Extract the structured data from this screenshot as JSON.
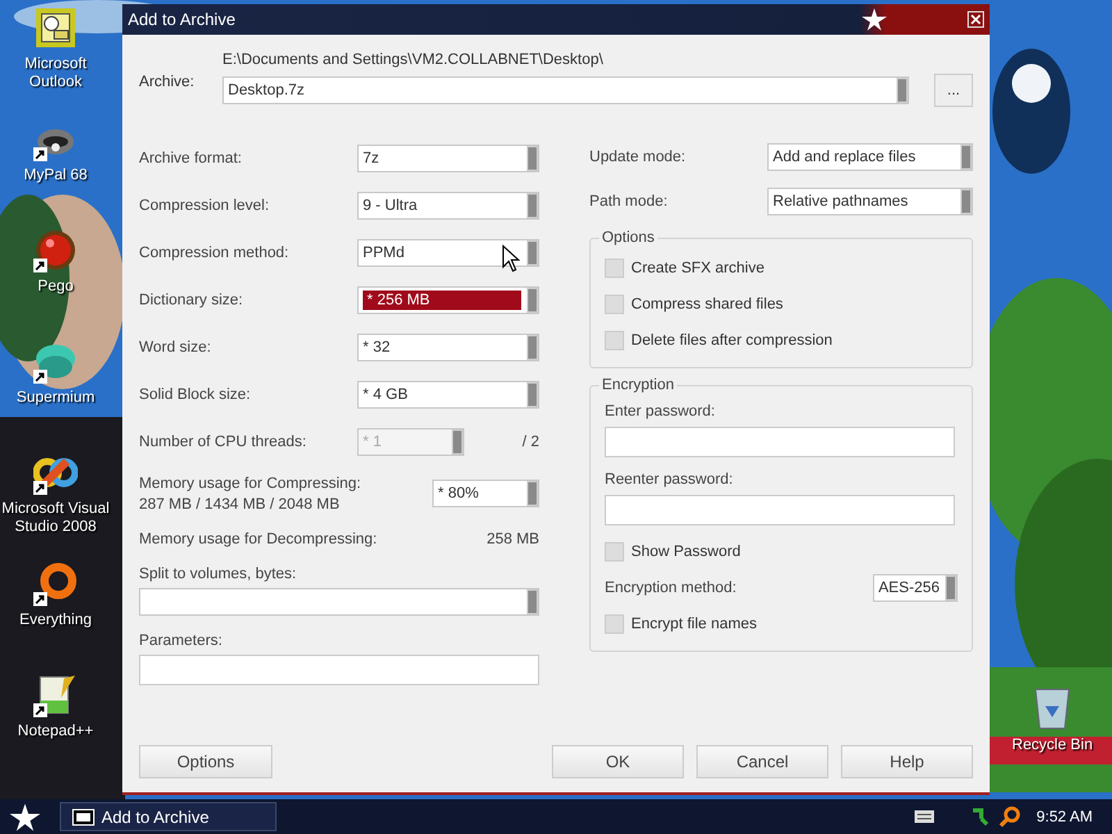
{
  "desktop_icons": [
    {
      "label": "Microsoft Outlook",
      "kind": "outlook",
      "shortcut": false
    },
    {
      "label": "MyPal 68",
      "kind": "raccoon",
      "shortcut": true
    },
    {
      "label": "Pego",
      "kind": "red-ball",
      "shortcut": true
    },
    {
      "label": "Supermium",
      "kind": "teal-blob",
      "shortcut": true
    },
    {
      "label": "Microsoft Visual Studio 2008",
      "kind": "infinity",
      "shortcut": true
    },
    {
      "label": "Everything",
      "kind": "ring",
      "shortcut": true
    },
    {
      "label": "Notepad++",
      "kind": "notepad",
      "shortcut": true
    }
  ],
  "recycle_bin": {
    "label": "Recycle Bin"
  },
  "window": {
    "title": "Add to Archive",
    "archive": {
      "label": "Archive:",
      "path": "E:\\Documents and Settings\\VM2.COLLABNET\\Desktop\\",
      "value": "Desktop.7z",
      "browse": "..."
    },
    "left_rows": [
      {
        "label": "Archive format:",
        "value": "7z",
        "highlighted": false
      },
      {
        "label": "Compression level:",
        "value": "9 - Ultra",
        "highlighted": false
      },
      {
        "label": "Compression method:",
        "value": "PPMd",
        "highlighted": false
      },
      {
        "label": "Dictionary size:",
        "value": "* 256 MB",
        "highlighted": true
      },
      {
        "label": "Word size:",
        "value": "* 32",
        "highlighted": false
      },
      {
        "label": "Solid Block size:",
        "value": "* 4 GB",
        "highlighted": false
      }
    ],
    "cpu_threads": {
      "label": "Number of CPU threads:",
      "value": "* 1",
      "disabled": true,
      "max": "/ 2"
    },
    "memory_compress": {
      "label": "Memory usage for Compressing:",
      "detail": "287 MB / 1434 MB / 2048 MB",
      "value": "* 80%"
    },
    "memory_decompress": {
      "label": "Memory usage for Decompressing:",
      "value": "258 MB"
    },
    "split": {
      "label": "Split to volumes, bytes:"
    },
    "parameters": {
      "label": "Parameters:"
    },
    "options_button": "Options",
    "right_rows": [
      {
        "label": "Update mode:",
        "value": "Add and replace files"
      },
      {
        "label": "Path mode:",
        "value": "Relative pathnames"
      }
    ],
    "options_group": {
      "title": "Options",
      "checkboxes": [
        {
          "label": "Create SFX archive",
          "checked": false
        },
        {
          "label": "Compress shared files",
          "checked": false
        },
        {
          "label": "Delete files after compression",
          "checked": false
        }
      ]
    },
    "encryption": {
      "title": "Encryption",
      "password_label": "Enter password:",
      "reenter_label": "Reenter password:",
      "show_password": {
        "label": "Show Password",
        "checked": false
      },
      "method_label": "Encryption method:",
      "method": "AES-256",
      "encrypt_names": {
        "label": "Encrypt file names",
        "checked": false
      }
    },
    "buttons": [
      "OK",
      "Cancel",
      "Help"
    ]
  },
  "taskbar": {
    "task": "Add to Archive",
    "clock": "9:52 AM"
  }
}
